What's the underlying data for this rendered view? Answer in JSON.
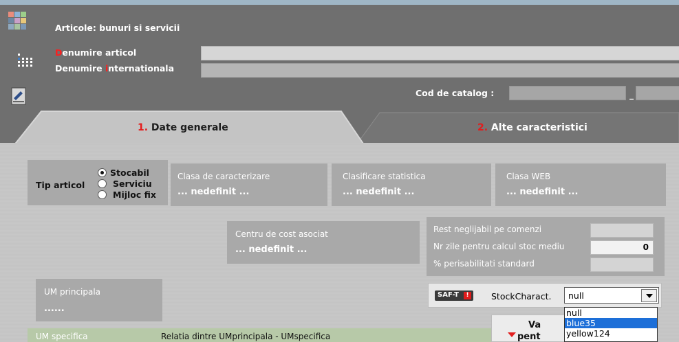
{
  "window": {
    "title": "Articole: bunuri si servicii"
  },
  "fields": {
    "denumire_articol": {
      "label_first": "D",
      "label_rest": "enumire articol",
      "value": ""
    },
    "denumire_internationala": {
      "label_pre": "Denumire ",
      "label_hl": "i",
      "label_rest": "nternationala",
      "value": ""
    },
    "cod_catalog": {
      "label": "Cod de catalog :",
      "value1": "",
      "separator": "_",
      "value2": ""
    }
  },
  "tabs": [
    {
      "number": "1.",
      "label": " Date generale",
      "active": true
    },
    {
      "number": "2.",
      "label": " Alte caracteristici",
      "active": false
    }
  ],
  "tip_articol": {
    "label": "Tip articol",
    "options": [
      "Stocabil",
      "Serviciu",
      "Mijloc fix"
    ],
    "selected": "Stocabil"
  },
  "classifiers": {
    "clasa_caracterizare": {
      "label": "Clasa de caracterizare",
      "value": "... nedefinit ..."
    },
    "clasificare_statistica": {
      "label": "Clasificare statistica",
      "value": "... nedefinit ..."
    },
    "clasa_web": {
      "label": "Clasa WEB",
      "value": "... nedefinit ..."
    },
    "centru_cost": {
      "label": "Centru de cost asociat",
      "value": "... nedefinit ..."
    }
  },
  "stock_params": [
    {
      "label": "Rest neglijabil pe comenzi",
      "value": ""
    },
    {
      "label": "Nr zile pentru calcul stoc mediu",
      "value": "0"
    },
    {
      "label": "% perisabilitati standard",
      "value": ""
    }
  ],
  "um_principala": {
    "label": "UM principala",
    "value": "......"
  },
  "saft": {
    "logo_text": "SAF-T",
    "logo_badge": "!",
    "stock_label": "StockCharact.",
    "selected": "null",
    "options": [
      "null",
      "blue35",
      "yellow124"
    ],
    "highlighted": "blue35"
  },
  "bottom": {
    "um_specifica": "UM specifica",
    "relatia": "Relatia dintre UMprincipala - UMspecifica",
    "val_line1": "Va",
    "val_line2": "pent"
  },
  "colors": {
    "accent_red": "#e41b1b",
    "selection_blue": "#1d6fd8"
  },
  "icons": [
    "app-logo-icon",
    "grid-icon",
    "pen-icon",
    "radio-icon",
    "dropdown-arrow-icon",
    "warning-badge-icon",
    "triangle-down-icon"
  ]
}
